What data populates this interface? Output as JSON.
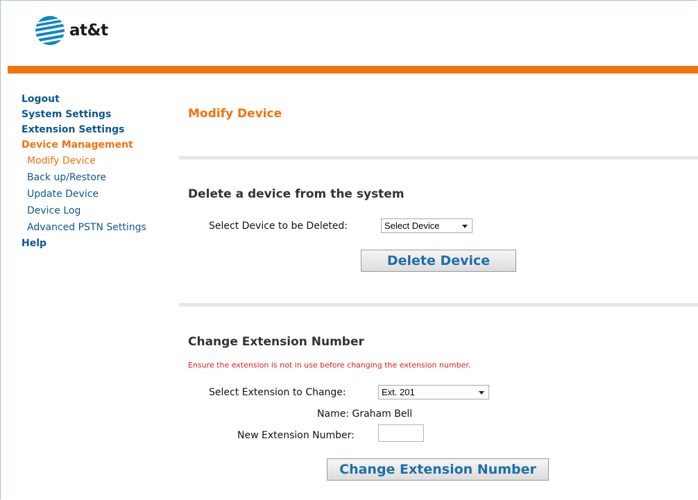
{
  "brand": {
    "logo_text": "at&t"
  },
  "sidebar": {
    "items": [
      {
        "label": "Logout",
        "level": "main",
        "active": false
      },
      {
        "label": "System Settings",
        "level": "main",
        "active": false
      },
      {
        "label": "Extension Settings",
        "level": "main",
        "active": false
      },
      {
        "label": "Device Management",
        "level": "main",
        "active": true
      },
      {
        "label": "Modify Device",
        "level": "sub",
        "active": true
      },
      {
        "label": "Back up/Restore",
        "level": "sub",
        "active": false
      },
      {
        "label": "Update Device",
        "level": "sub",
        "active": false
      },
      {
        "label": "Device Log",
        "level": "sub",
        "active": false
      },
      {
        "label": "Advanced PSTN Settings",
        "level": "sub",
        "active": false
      },
      {
        "label": "Help",
        "level": "main",
        "active": false
      }
    ]
  },
  "page": {
    "title": "Modify Device"
  },
  "delete_section": {
    "title": "Delete a device from the system",
    "select_label": "Select Device to be Deleted:",
    "select_value": "Select Device",
    "button_label": "Delete Device"
  },
  "change_section": {
    "title": "Change Extension Number",
    "warning": "Ensure the extension is not in use before changing the extension number.",
    "select_label": "Select Extension to Change:",
    "select_value": "Ext. 201",
    "name_text": "Name: Graham Bell",
    "new_ext_label": "New Extension Number:",
    "new_ext_value": "",
    "button_label": "Change Extension Number"
  },
  "colors": {
    "accent_orange": "#f2730e",
    "link_blue": "#0b5790",
    "button_text_blue": "#1f6fa8",
    "warning_red": "#e02020"
  }
}
